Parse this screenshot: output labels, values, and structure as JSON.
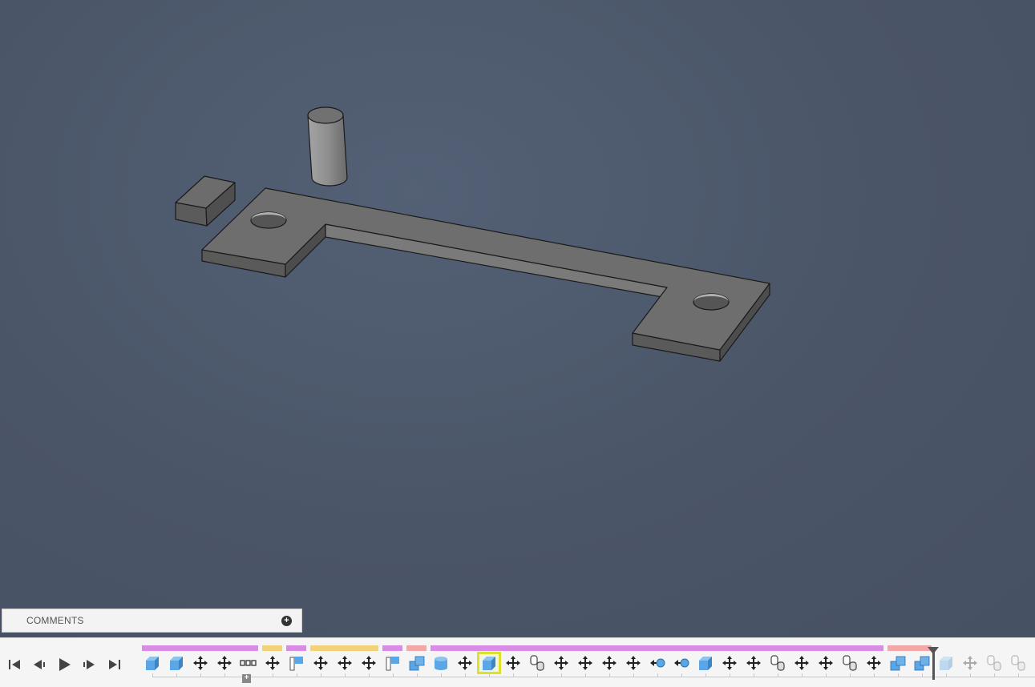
{
  "comments": {
    "label": "COMMENTS",
    "add_icon": "+"
  },
  "timeline": {
    "expand_icon": "+",
    "playback": [
      "skip-to-start",
      "step-back",
      "play",
      "step-forward",
      "skip-to-end"
    ],
    "groups": [
      {
        "color": "#d98be6"
      },
      {
        "color": "#f3d27a"
      },
      {
        "color": "#d98be6"
      },
      {
        "color": "#f3d27a"
      },
      {
        "color": "#d98be6"
      },
      {
        "color": "#f4a7a7"
      },
      {
        "color": "#d98be6"
      },
      {
        "color": "#f4a7a7"
      }
    ],
    "features": [
      "extrude-icon",
      "extrude-icon",
      "move-icon",
      "move-icon",
      "pattern-icon",
      "move-icon",
      "sketch-icon",
      "move-icon",
      "move-icon",
      "move-icon",
      "sketch-icon",
      "combine-icon",
      "cylinder-icon",
      "move-icon",
      "box-icon",
      "move-icon",
      "joint-icon",
      "move-icon",
      "move-icon",
      "move-icon",
      "move-icon",
      "point-left-icon",
      "point-left-icon",
      "box-icon",
      "move-icon",
      "move-icon",
      "joint-icon",
      "move-icon",
      "move-icon",
      "joint-icon",
      "move-icon",
      "combine-icon",
      "combine-icon",
      "box-icon",
      "move-icon",
      "joint-icon",
      "joint-icon"
    ],
    "selected_index": 14,
    "marker_after_index": 32
  },
  "colors": {
    "viewport_bg": "#4a5568",
    "part_fill": "#6e6e6e",
    "accent": "#5aa6e6",
    "selection": "#dce22b"
  }
}
